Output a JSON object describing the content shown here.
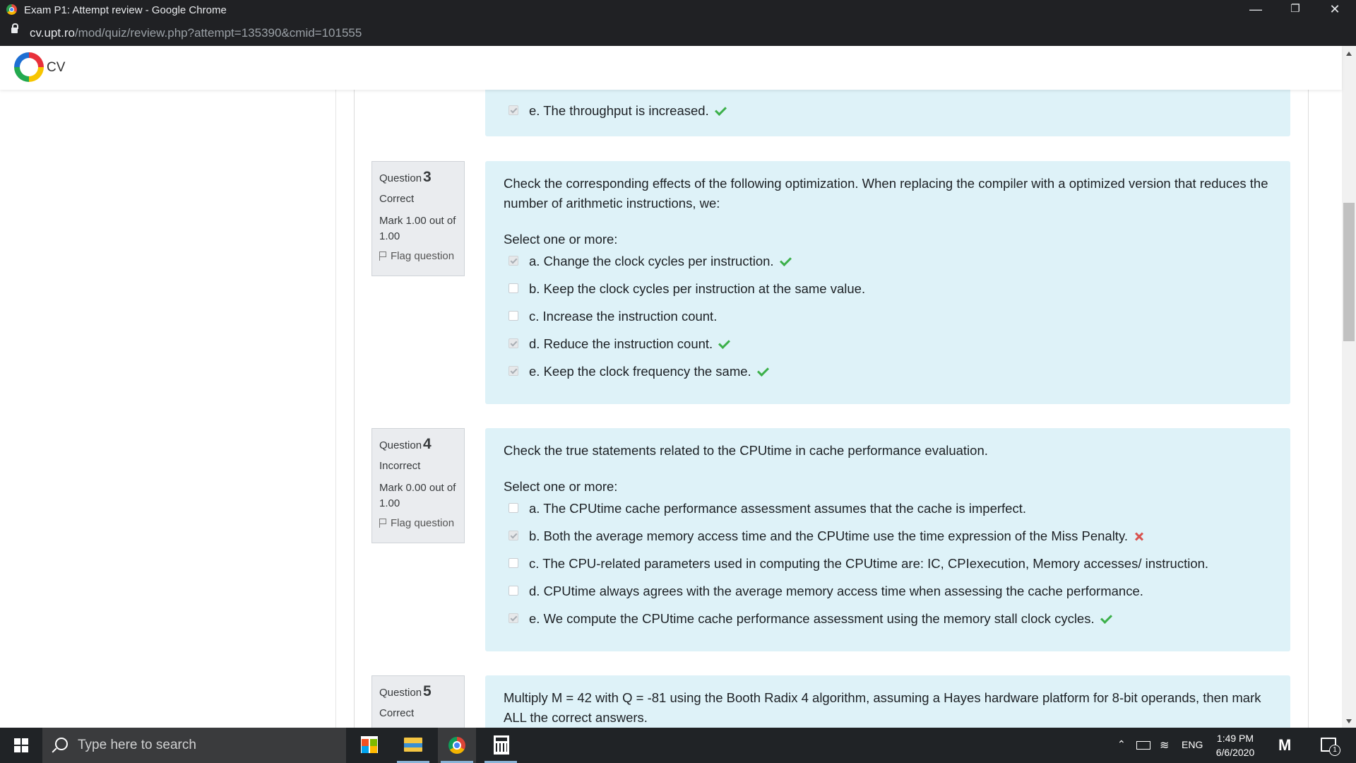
{
  "browser": {
    "window_title": "Exam P1: Attempt review - Google Chrome",
    "url_host": "cv.upt.ro",
    "url_path": "/mod/quiz/review.php?attempt=135390&cmid=101555"
  },
  "site": {
    "brand": "CV"
  },
  "prev_question_tail": {
    "answers": [
      {
        "text": "e. The throughput is increased.",
        "checked": true,
        "mark": "correct"
      }
    ]
  },
  "questions": [
    {
      "label": "Question",
      "number": "3",
      "state": "Correct",
      "grade": "Mark 1.00 out of 1.00",
      "flag": "Flag question",
      "text": "Check the corresponding effects of the following optimization. When replacing the compiler with a optimized version that reduces the number of arithmetic instructions, we:",
      "prompt": "Select one or more:",
      "answers": [
        {
          "text": "a. Change the clock cycles per instruction.",
          "checked": true,
          "mark": "correct"
        },
        {
          "text": "b. Keep the clock cycles per instruction at the same value.",
          "checked": false,
          "mark": "none"
        },
        {
          "text": "c. Increase the instruction count.",
          "checked": false,
          "mark": "none"
        },
        {
          "text": "d. Reduce the instruction count.",
          "checked": true,
          "mark": "correct"
        },
        {
          "text": "e. Keep the clock frequency the same.",
          "checked": true,
          "mark": "correct"
        }
      ]
    },
    {
      "label": "Question",
      "number": "4",
      "state": "Incorrect",
      "grade": "Mark 0.00 out of 1.00",
      "flag": "Flag question",
      "text": "Check the true statements related to the CPUtime in cache performance evaluation.",
      "prompt": "Select one or more:",
      "answers": [
        {
          "text": "a. The CPUtime cache performance assessment assumes that the cache is imperfect.",
          "checked": false,
          "mark": "none"
        },
        {
          "text": "b. Both the average memory access time and the CPUtime use the time expression of the Miss Penalty.",
          "checked": true,
          "mark": "incorrect"
        },
        {
          "text": "c. The CPU-related parameters used in computing the CPUtime are: IC, CPIexecution, Memory accesses/ instruction.",
          "checked": false,
          "mark": "none"
        },
        {
          "text": "d. CPUtime always agrees with the average memory access time when assessing the cache performance.",
          "checked": false,
          "mark": "none"
        },
        {
          "text": "e. We compute the CPUtime cache performance assessment using the memory stall clock cycles.",
          "checked": true,
          "mark": "correct"
        }
      ]
    },
    {
      "label": "Question",
      "number": "5",
      "state": "Correct",
      "text": "Multiply M = 42 with Q = -81 using the Booth Radix 4 algorithm, assuming a Hayes hardware platform for 8-bit operands, then mark ALL the correct answers."
    }
  ],
  "taskbar": {
    "search_placeholder": "Type here to search",
    "language": "ENG",
    "time": "1:49 PM",
    "date": "6/6/2020",
    "notification_count": "1"
  },
  "colors": {
    "correct": "#3cb04a",
    "incorrect": "#d9534f",
    "question_bg": "#def2f8"
  }
}
